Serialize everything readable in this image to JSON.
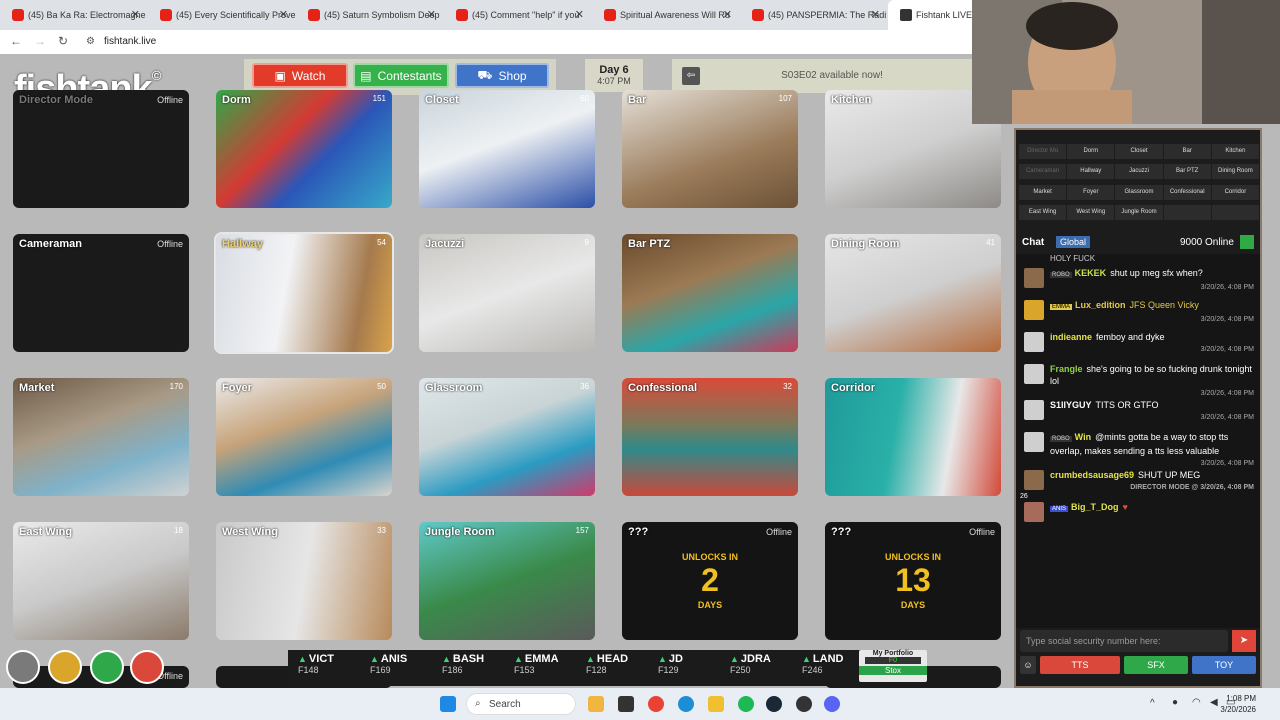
{
  "browser": {
    "tabs": [
      {
        "title": "(45) Ba Ka Ra: Electromagne",
        "color": "#e62117"
      },
      {
        "title": "(45) Every Scientifically Prove",
        "color": "#e62117"
      },
      {
        "title": "(45) Saturn Symbolism Deep",
        "color": "#e62117"
      },
      {
        "title": "(45) Comment \"help\" if you",
        "color": "#e62117"
      },
      {
        "title": "Spiritual Awareness Will Ru",
        "color": "#e62117"
      },
      {
        "title": "(45) PANSPERMIA: The Radi",
        "color": "#e62117"
      },
      {
        "title": "Fishtank LIVE",
        "color": "#222222"
      }
    ],
    "url": "fishtank.live"
  },
  "header": {
    "logo": "fishtank",
    "logo_reg": "©",
    "watch": "Watch",
    "contestants": "Contestants",
    "shop": "Shop",
    "day": "Day 6",
    "time": "4:07 PM",
    "notice": "S03E02 available now!"
  },
  "cameras": [
    {
      "name": "Director Mode",
      "status": "Offline"
    },
    {
      "name": "Dorm",
      "count": "151"
    },
    {
      "name": "Closet",
      "count": "60"
    },
    {
      "name": "Bar",
      "count": "107"
    },
    {
      "name": "Kitchen",
      "count": ""
    },
    {
      "name": "Cameraman",
      "status": "Offline"
    },
    {
      "name": "Hallway",
      "count": "54"
    },
    {
      "name": "Jacuzzi",
      "count": "9"
    },
    {
      "name": "Bar PTZ",
      "count": ""
    },
    {
      "name": "Dining Room",
      "count": "41"
    },
    {
      "name": "Market",
      "count": "170"
    },
    {
      "name": "Foyer",
      "count": "50"
    },
    {
      "name": "Glassroom",
      "count": "36"
    },
    {
      "name": "Confessional",
      "count": "32"
    },
    {
      "name": "Corridor",
      "count": ""
    },
    {
      "name": "East Wing",
      "count": "18"
    },
    {
      "name": "West Wing",
      "count": "33"
    },
    {
      "name": "Jungle Room",
      "count": "157"
    },
    {
      "name": "???",
      "status": "Offline",
      "unlocks_label": "UNLOCKS IN",
      "unlocks_num": "2",
      "unlocks_unit": "DAYS"
    },
    {
      "name": "???",
      "status": "Offline",
      "unlocks_label": "UNLOCKS IN",
      "unlocks_num": "13",
      "unlocks_unit": "DAYS"
    }
  ],
  "bottom_offline": "Offline",
  "stocks": [
    {
      "sym": "VICT",
      "price": "F148"
    },
    {
      "sym": "ANIS",
      "price": "F169"
    },
    {
      "sym": "BASH",
      "price": "F186"
    },
    {
      "sym": "EMMA",
      "price": "F153"
    },
    {
      "sym": "HEAD",
      "price": "F128"
    },
    {
      "sym": "JD",
      "price": "F129"
    },
    {
      "sym": "JDRA",
      "price": "F250"
    },
    {
      "sym": "LAND",
      "price": "F246"
    }
  ],
  "portfolio": {
    "label": "My Portfolio",
    "value": "F0",
    "button": "Stox"
  },
  "side_grid": [
    "Director Mo",
    "Dorm",
    "Closet",
    "Bar",
    "Kitchen",
    "Cameraman",
    "Hallway",
    "Jacuzzi",
    "Bar PTZ",
    "Dining Room",
    "Market",
    "Foyer",
    "Glassroom",
    "Confessional",
    "Corridor",
    "East Wing",
    "West Wing",
    "Jungle Room",
    "",
    ""
  ],
  "chat": {
    "title": "Chat",
    "channel": "Global",
    "online": "9000 Online",
    "top_text": "HOLY FUCK",
    "messages": [
      {
        "badge": "ROBO",
        "user": "KEKEK",
        "text": "shut up meg sfx when?",
        "ts": "3/20/26, 4:08 PM",
        "color": "#c7e34a"
      },
      {
        "badge": "EMMA",
        "user": "Lux_edition",
        "text": "JFS Queen Vicky",
        "ts": "3/20/26, 4:08 PM",
        "color": "#e3c94a"
      },
      {
        "badge": "",
        "user": "indieanne",
        "text": "femboy and dyke",
        "ts": "3/20/26, 4:08 PM",
        "color": "#e3e34a"
      },
      {
        "badge": "",
        "user": "Frangle",
        "text": "she's going to be so fucking drunk tonight lol",
        "ts": "3/20/26, 4:08 PM",
        "color": "#8fd14a"
      },
      {
        "badge": "",
        "user": "S1llYGUY",
        "text": "TITS OR GTFO",
        "ts": "3/20/26, 4:08 PM",
        "color": "#ffffff"
      },
      {
        "badge": "ROBO",
        "user": "Win",
        "text": "@mints gotta be a way to stop tts overlap, makes sending a tts less valuable",
        "ts": "3/20/26, 4:08 PM",
        "color": "#e3e34a"
      },
      {
        "badge": "",
        "user": "crumbedsausage69",
        "text": "SHUT UP MEG",
        "ts": "DIRECTOR MODE @ 3/20/26, 4:08 PM",
        "color": "#e3e34a"
      },
      {
        "badge": "ANIS",
        "user": "Big_T_Dog",
        "text": "",
        "ts": "",
        "color": "#e3e34a"
      }
    ],
    "level": "26",
    "placeholder": "Type social security number here:",
    "tts": "TTS",
    "sfx": "SFX",
    "toy": "TOY"
  },
  "taskbar": {
    "search": "Search",
    "time": "1:08 PM",
    "date": "3/20/2026"
  }
}
